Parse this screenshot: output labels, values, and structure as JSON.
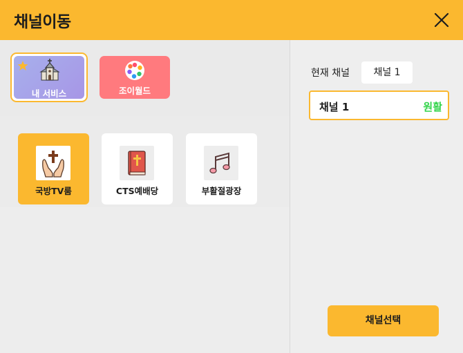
{
  "dialog": {
    "title": "채널이동",
    "close_icon": "close-icon"
  },
  "services": [
    {
      "label": "내 서비스",
      "icon": "church-icon",
      "badge_icon": "star-icon",
      "selected": true
    },
    {
      "label": "조이월드",
      "icon": "joyworld-logo-icon",
      "selected": false
    }
  ],
  "rooms": [
    {
      "label": "국방TV룸",
      "icon": "praying-hands-cross-icon",
      "active": true
    },
    {
      "label": "CTS예배당",
      "icon": "bible-icon",
      "active": false
    },
    {
      "label": "부활절광장",
      "icon": "music-notes-icon",
      "active": false
    }
  ],
  "current_channel": {
    "label": "현재 채널",
    "value": "채널 1"
  },
  "channel_list": [
    {
      "name": "채널 1",
      "status": "원활",
      "status_color": "#33d44a"
    }
  ],
  "actions": {
    "select_label": "채널선택"
  },
  "colors": {
    "accent": "#fbb82f",
    "my_service_bg": "#a79fe9",
    "joyworld_bg": "#ff7a7e"
  }
}
